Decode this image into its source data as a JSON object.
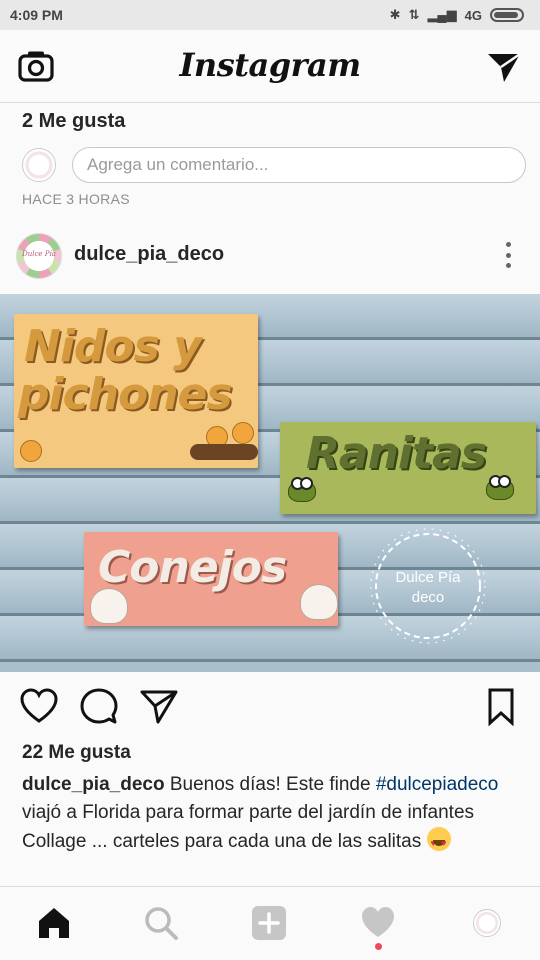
{
  "status_bar": {
    "time": "4:09 PM",
    "network": "4G",
    "icons": [
      "bluetooth-icon",
      "data-transfer-icon",
      "signal-icon",
      "battery-icon"
    ]
  },
  "app_bar": {
    "logo": "Instagram",
    "left_icon": "camera-icon",
    "right_icon": "direct-send-icon"
  },
  "previous_post": {
    "likes": "2 Me gusta",
    "comment_placeholder": "Agrega un comentario...",
    "time_ago": "HACE 3 HORAS"
  },
  "post": {
    "username": "dulce_pia_deco",
    "avatar_text": "Dulce Pía",
    "photo": {
      "signs": [
        "Nidos y",
        "pichones",
        "Ranitas",
        "Conejos"
      ],
      "watermark_line1": "Dulce Pía",
      "watermark_line2": "deco"
    },
    "actions": [
      "heart-icon",
      "comment-icon",
      "share-icon",
      "bookmark-icon"
    ],
    "likes": "22 Me gusta",
    "caption": {
      "user": "dulce_pia_deco",
      "text_part1": " Buenos días! Este finde ",
      "hashtag": "#dulcepiadeco",
      "text_part2": " viajó a Florida para formar parte del jardín de infantes Collage ... carteles para cada una de las salitas ",
      "emoji": "heart-eyes-emoji"
    }
  },
  "bottom_nav": {
    "items": [
      "home-icon",
      "search-icon",
      "add-icon",
      "activity-heart-icon",
      "profile-avatar"
    ],
    "active": "home-icon",
    "notification_dot_color": "#ed4956"
  },
  "colors": {
    "hashtag": "#003569",
    "border": "#dbdbdb",
    "muted_text": "#8e8e8e"
  }
}
